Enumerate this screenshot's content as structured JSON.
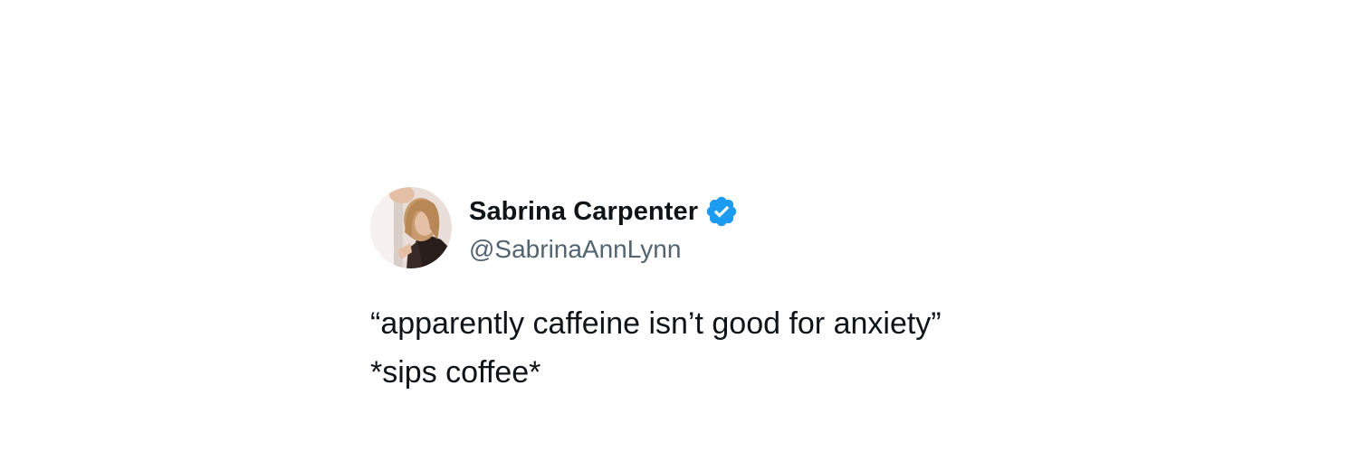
{
  "tweet": {
    "author": {
      "display_name": "Sabrina Carpenter",
      "handle": "@SabrinaAnnLynn",
      "verified": true,
      "avatar_icon": "profile-photo"
    },
    "text_lines": [
      "“apparently caffeine isn’t good for anxiety”",
      "*sips coffee*"
    ]
  },
  "colors": {
    "background": "#ffffff",
    "text_primary": "#0f1419",
    "text_secondary": "#536471",
    "verified_badge": "#1d9bf0"
  }
}
